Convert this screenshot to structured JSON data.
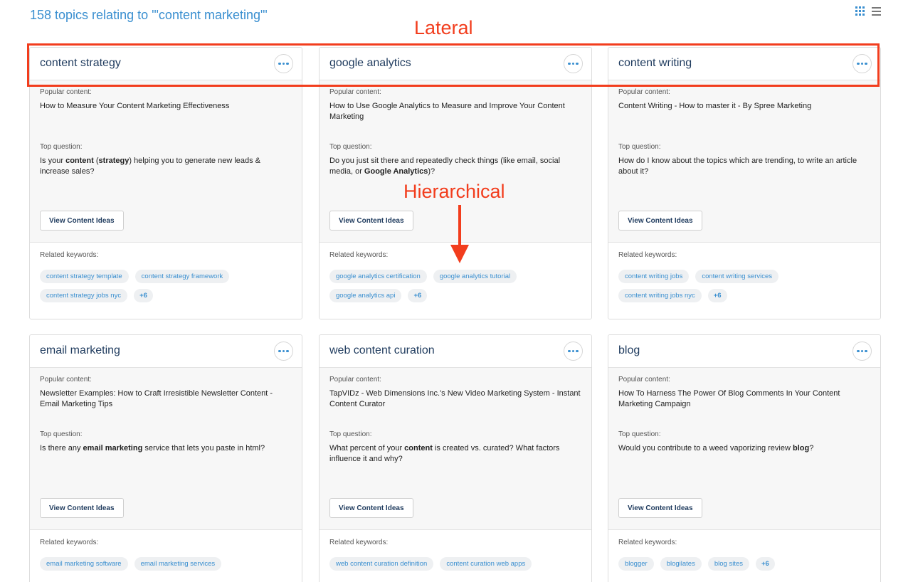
{
  "header": {
    "title": "158 topics relating to '\"content marketing\"'"
  },
  "labels": {
    "popular_content": "Popular content:",
    "top_question": "Top question:",
    "view_ideas": "View Content Ideas",
    "related_keywords": "Related keywords:"
  },
  "icons": {
    "view_grid": "grid-view-icon",
    "view_list": "list-view-icon",
    "more": "ellipsis-icon"
  },
  "colors": {
    "accent": "#3a8fd0",
    "title": "#1f3b5e",
    "annotation": "#f23d1d"
  },
  "annotations": {
    "lateral": "Lateral",
    "hierarchical": "Hierarchical"
  },
  "cards": [
    {
      "title": "content strategy",
      "popular": "How to Measure Your Content Marketing Effectiveness",
      "question": [
        {
          "t": "Is your ",
          "b": false
        },
        {
          "t": "content",
          "b": true
        },
        {
          "t": " (",
          "b": false
        },
        {
          "t": "strategy",
          "b": true
        },
        {
          "t": ") helping you to generate new leads & increase sales?",
          "b": false
        }
      ],
      "keywords": [
        "content strategy template",
        "content strategy framework",
        "content strategy jobs nyc"
      ],
      "more": "+6"
    },
    {
      "title": "google analytics",
      "popular": "How to Use Google Analytics to Measure and Improve Your Content Marketing",
      "question": [
        {
          "t": "Do you just sit there and repeatedly check things (like email, social media, or ",
          "b": false
        },
        {
          "t": "Google Analytics",
          "b": true
        },
        {
          "t": ")?",
          "b": false
        }
      ],
      "keywords": [
        "google analytics certification",
        "google analytics tutorial",
        "google analytics api"
      ],
      "more": "+6"
    },
    {
      "title": "content writing",
      "popular": "Content Writing - How to master it - By Spree Marketing",
      "question": [
        {
          "t": "How do I know about the topics which are trending, to write an article about it?",
          "b": false
        }
      ],
      "keywords": [
        "content writing jobs",
        "content writing services",
        "content writing jobs nyc"
      ],
      "more": "+6"
    },
    {
      "title": "email marketing",
      "popular": "Newsletter Examples: How to Craft Irresistible Newsletter Content - Email Marketing Tips",
      "question": [
        {
          "t": "Is there any ",
          "b": false
        },
        {
          "t": "email marketing",
          "b": true
        },
        {
          "t": " service that lets you paste in html?",
          "b": false
        }
      ],
      "keywords": [
        "email marketing software",
        "email marketing services"
      ],
      "more": ""
    },
    {
      "title": "web content curation",
      "popular": "TapVIDz - Web Dimensions Inc.'s New Video Marketing System - Instant Content Curator",
      "question": [
        {
          "t": "What percent of your ",
          "b": false
        },
        {
          "t": "content",
          "b": true
        },
        {
          "t": " is created vs. curated? What factors influence it and why?",
          "b": false
        }
      ],
      "keywords": [
        "web content curation definition",
        "content curation web apps"
      ],
      "more": ""
    },
    {
      "title": "blog",
      "popular": "How To Harness The Power Of Blog Comments In Your Content Marketing Campaign",
      "question": [
        {
          "t": "Would you contribute to a weed vaporizing review ",
          "b": false
        },
        {
          "t": "blog",
          "b": true
        },
        {
          "t": "?",
          "b": false
        }
      ],
      "keywords": [
        "blogger",
        "blogilates",
        "blog sites"
      ],
      "more": "+6"
    }
  ]
}
